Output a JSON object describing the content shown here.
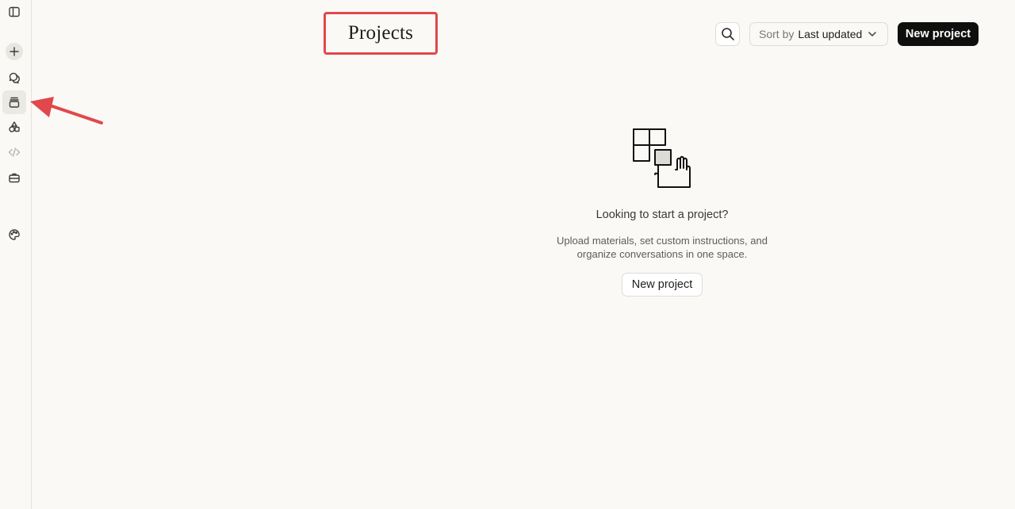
{
  "header": {
    "title": "Projects",
    "sort_prefix": "Sort by",
    "sort_value": "Last updated",
    "new_project_label": "New project"
  },
  "sidebar": {
    "items": [
      {
        "name": "toggle-sidebar",
        "icon": "sidebar-icon"
      },
      {
        "name": "new-chat",
        "icon": "plus-icon"
      },
      {
        "name": "chats",
        "icon": "chat-bubbles-icon"
      },
      {
        "name": "projects",
        "icon": "stack-icon",
        "active": true
      },
      {
        "name": "artifacts",
        "icon": "shapes-icon"
      },
      {
        "name": "code",
        "icon": "code-icon"
      },
      {
        "name": "tools",
        "icon": "briefcase-icon"
      },
      {
        "name": "appearance",
        "icon": "palette-icon"
      }
    ]
  },
  "empty_state": {
    "title": "Looking to start a project?",
    "description_line1": "Upload materials, set custom instructions, and",
    "description_line2": "organize conversations in one space.",
    "button_label": "New project",
    "illustration": "grid-hand-illustration"
  },
  "colors": {
    "background": "#faf9f6",
    "primary_button": "#0f0f0e",
    "annotation": "#e0484c"
  }
}
